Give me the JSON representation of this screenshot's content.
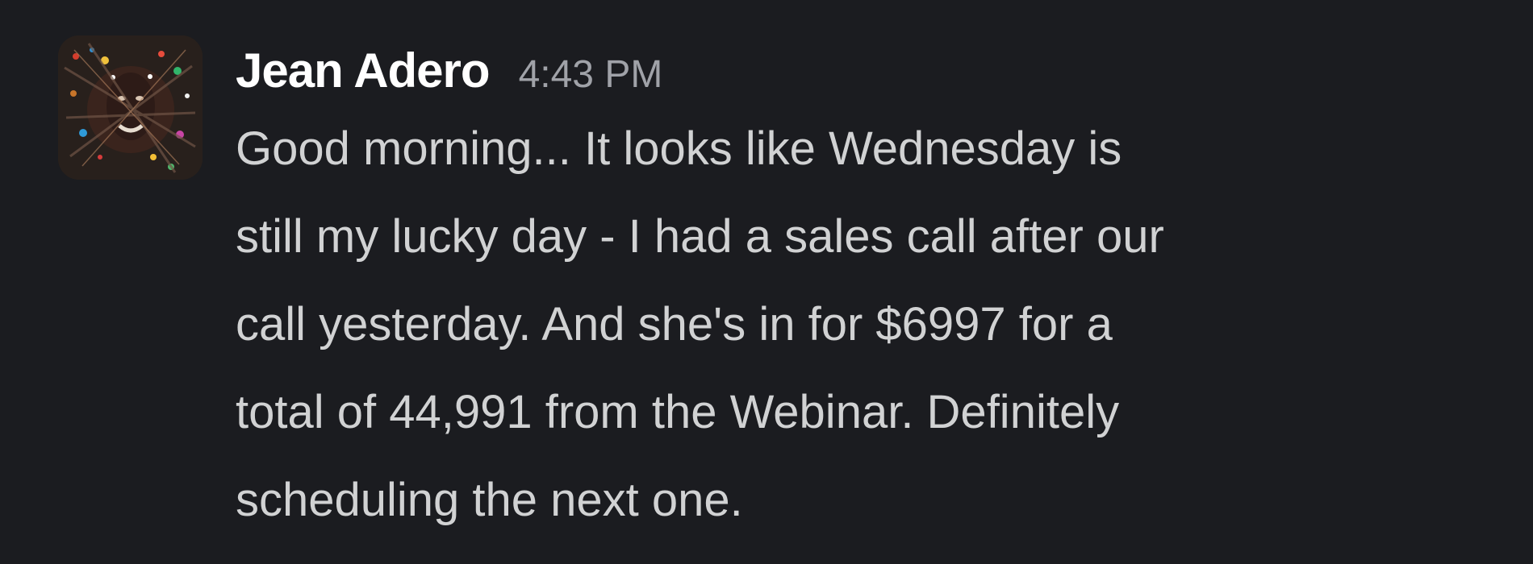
{
  "message": {
    "author": "Jean Adero",
    "timestamp": "4:43 PM",
    "lines": [
      "Good morning... It looks like Wednesday is",
      "still my lucky day - I had a sales call after our",
      "call yesterday. And she's in for $6997 for a",
      "total of 44,991 from the Webinar. Definitely",
      "scheduling the next one."
    ]
  }
}
